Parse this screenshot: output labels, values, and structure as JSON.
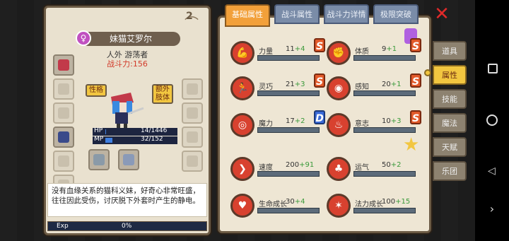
{
  "character": {
    "name": "妹猫艾罗尔",
    "gender_symbol": "♀",
    "costume_count": "2",
    "race": "人外 游荡者",
    "power": "战斗力:156",
    "tag_personality": "性格",
    "tag_extra_limb": "额外肢体",
    "hp_label": "HP",
    "hp_value": "14/1446",
    "mp_label": "MP",
    "mp_value": "32/152",
    "hp_ratio": 0.01,
    "mp_ratio": 0.21,
    "description": "没有血缘关系的猫科义妹，好奇心非常旺盛，往往因此受伤，讨厌脱下外套时产生的静电。",
    "exp_label": "Exp",
    "exp_value": "0%"
  },
  "tabs": [
    {
      "label": "基础属性",
      "active": true
    },
    {
      "label": "战斗属性",
      "active": false
    },
    {
      "label": "战斗力详情",
      "active": false
    },
    {
      "label": "极限突破",
      "active": false
    }
  ],
  "stats": [
    {
      "name": "力量",
      "base": "11",
      "bonus": "+4",
      "grade": "S",
      "icon": "muscle-icon"
    },
    {
      "name": "体质",
      "base": "9",
      "bonus": "+1",
      "grade": "S",
      "icon": "fist-icon"
    },
    {
      "name": "灵巧",
      "base": "21",
      "bonus": "+3",
      "grade": "S",
      "icon": "runner-icon"
    },
    {
      "name": "感知",
      "base": "20",
      "bonus": "+1",
      "grade": "S",
      "icon": "eye-icon"
    },
    {
      "name": "魔力",
      "base": "17",
      "bonus": "+2",
      "grade": "D",
      "icon": "swirl-icon"
    },
    {
      "name": "意志",
      "base": "10",
      "bonus": "+3",
      "grade": "S",
      "icon": "fire-icon"
    },
    {
      "name": "速度",
      "base": "200",
      "bonus": "+91",
      "grade": "",
      "icon": "wing-icon"
    },
    {
      "name": "运气",
      "base": "50",
      "bonus": "+2",
      "grade": "",
      "icon": "clover-icon"
    },
    {
      "name": "生命成长",
      "base": "30",
      "bonus": "+4",
      "grade": "",
      "icon": "heart-icon"
    },
    {
      "name": "法力成长",
      "base": "100",
      "bonus": "+15",
      "grade": "",
      "icon": "magic-circle-icon"
    }
  ],
  "side_tabs": [
    "道具",
    "属性",
    "技能",
    "魔法",
    "天赋",
    "乐团"
  ],
  "active_side_tab": "属性",
  "colors": {
    "accent": "#f2a03a",
    "grade_s": "#e25a2a",
    "grade_d": "#3a6ad8",
    "bonus": "#3a9a3a",
    "power": "#d23a2a"
  }
}
